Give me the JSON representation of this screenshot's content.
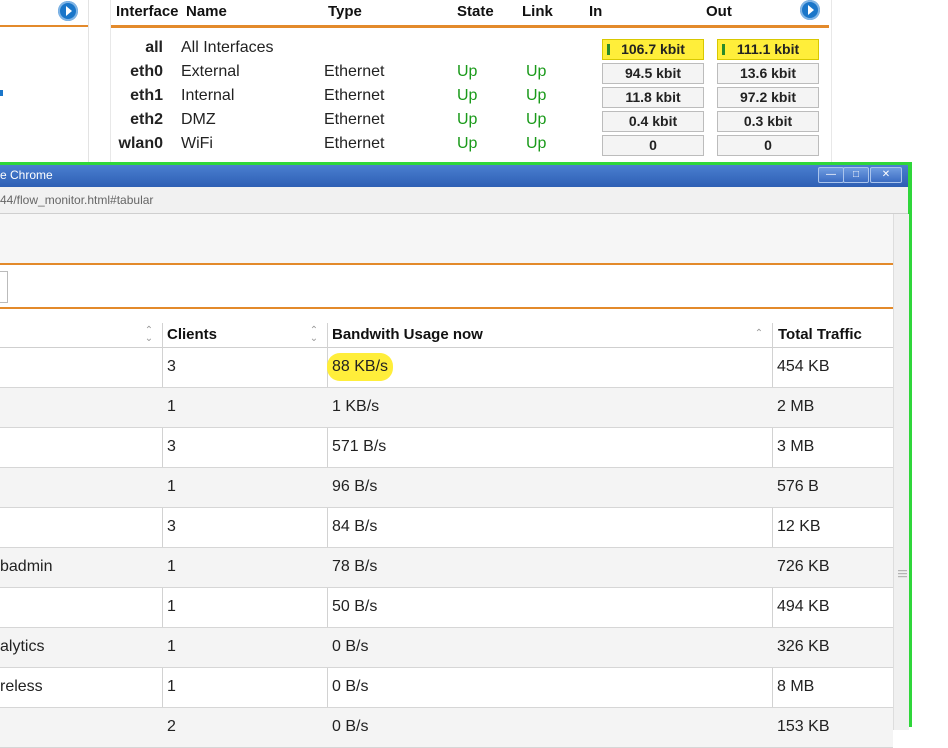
{
  "interfaces_panel": {
    "columns": [
      "Interface",
      "Name",
      "Type",
      "State",
      "Link",
      "In",
      "Out"
    ],
    "rows": [
      {
        "id": "all",
        "name": "All Interfaces",
        "type": "",
        "state": "",
        "link": "",
        "in": "106.7 kbit",
        "out": "111.1 kbit"
      },
      {
        "id": "eth0",
        "name": "External",
        "type": "Ethernet",
        "state": "Up",
        "link": "Up",
        "in": "94.5 kbit",
        "out": "13.6 kbit"
      },
      {
        "id": "eth1",
        "name": "Internal",
        "type": "Ethernet",
        "state": "Up",
        "link": "Up",
        "in": "11.8 kbit",
        "out": "97.2 kbit"
      },
      {
        "id": "eth2",
        "name": "DMZ",
        "type": "Ethernet",
        "state": "Up",
        "link": "Up",
        "in": "0.4 kbit",
        "out": "0.3 kbit"
      },
      {
        "id": "wlan0",
        "name": "WiFi",
        "type": "Ethernet",
        "state": "Up",
        "link": "Up",
        "in": "0",
        "out": "0"
      }
    ]
  },
  "window": {
    "title": "e Chrome",
    "url": "44/flow_monitor.html#tabular",
    "controls": {
      "minimize": "—",
      "maximize": "□",
      "close": "✕"
    }
  },
  "flow_table": {
    "columns": [
      "Clients",
      "Bandwith Usage now",
      "Total Traffic"
    ],
    "rows": [
      {
        "name": "",
        "clients": "3",
        "bandwidth": "88 KB/s",
        "total": "454 KB"
      },
      {
        "name": "",
        "clients": "1",
        "bandwidth": "1 KB/s",
        "total": "2 MB"
      },
      {
        "name": "",
        "clients": "3",
        "bandwidth": "571 B/s",
        "total": "3 MB"
      },
      {
        "name": "",
        "clients": "1",
        "bandwidth": "96 B/s",
        "total": "576 B"
      },
      {
        "name": "",
        "clients": "3",
        "bandwidth": "84 B/s",
        "total": "12 KB"
      },
      {
        "name": "badmin",
        "clients": "1",
        "bandwidth": "78 B/s",
        "total": "726 KB"
      },
      {
        "name": "",
        "clients": "1",
        "bandwidth": "50 B/s",
        "total": "494 KB"
      },
      {
        "name": "alytics",
        "clients": "1",
        "bandwidth": "0 B/s",
        "total": "326 KB"
      },
      {
        "name": "reless",
        "clients": "1",
        "bandwidth": "0 B/s",
        "total": "8 MB"
      },
      {
        "name": "",
        "clients": "2",
        "bandwidth": "0 B/s",
        "total": "153 KB"
      }
    ]
  },
  "colors": {
    "accent": "#e38a2b",
    "highlight": "#ffee3a",
    "window_border": "#2fd63a",
    "link_blue": "#1a76c9",
    "state_green": "#1a9a1a"
  }
}
